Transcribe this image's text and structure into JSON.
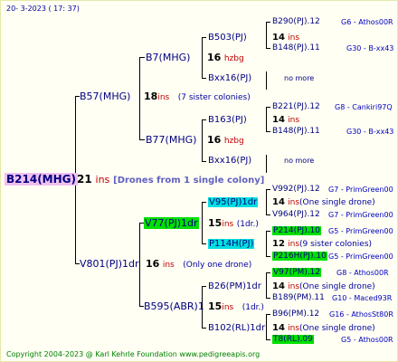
{
  "header": {
    "date": "20- 3-2023 ( 17: 37)"
  },
  "footer": {
    "copyright": "Copyright 2004-2023 @ Karl Kehrle Foundation www.pedigreeapis.org"
  },
  "root": {
    "name": "B214(MHG)",
    "ins_count": "21",
    "ins_label": "ins",
    "note": "[Drones from 1 single colony]"
  },
  "sire": {
    "name": "B57(MHG)",
    "ins_count": "18",
    "ins_label": "ins",
    "note": "(7 sister colonies)",
    "b7": {
      "name": "B7(MHG)",
      "ins_count": "16",
      "ins_label": "hzbg"
    },
    "b503": {
      "name": "B503(PJ)",
      "ins_count": "14",
      "ins_label": "ins"
    },
    "b290": {
      "name": "B290(PJ).12",
      "right": "G6 - Athos00R"
    },
    "b148a": {
      "name": "B148(PJ).11",
      "right": "G30 - B-xx43"
    },
    "bxx16a": {
      "name": "Bxx16(PJ)",
      "more": "no more"
    },
    "b77": {
      "name": "B77(MHG)",
      "ins_count": "16",
      "ins_label": "hzbg"
    },
    "b163": {
      "name": "B163(PJ)",
      "ins_count": "14",
      "ins_label": "ins"
    },
    "b221": {
      "name": "B221(PJ).12",
      "right": "G8 - Cankiri97Q"
    },
    "b148b": {
      "name": "B148(PJ).11",
      "right": "G30 - B-xx43"
    },
    "bxx16b": {
      "name": "Bxx16(PJ)",
      "more": "no more"
    }
  },
  "dam": {
    "name": "V801(PJ)1dr",
    "ins_count": "16",
    "ins_label": "ins",
    "note": "(Only one drone)",
    "v77": {
      "name": "V77(PJ)1dr",
      "ins_count": "15",
      "ins_label": "ins",
      "note": "(1dr.)"
    },
    "v95": {
      "name": "V95(PJ)1dr",
      "ins_count": "14",
      "ins_label": "ins",
      "note": "(One single drone)"
    },
    "v992": {
      "name": "V992(PJ).12",
      "right": "G7 - PrimGreen00"
    },
    "v964": {
      "name": "V964(PJ).12",
      "right": "G7 - PrimGreen00"
    },
    "p114": {
      "name": "P114H(PJ)",
      "ins_count": "12",
      "ins_label": "ins",
      "note": "(9 sister colonies)"
    },
    "p214": {
      "name": "P214(PJ).10",
      "right": "G5 - PrimGreen00"
    },
    "p216": {
      "name": "P216H(PJ).10",
      "right": "G5 - PrimGreen00"
    },
    "b595": {
      "name": "B595(ABR)1",
      "ins_count": "15",
      "ins_label": "ins",
      "note": "(1dr.)"
    },
    "b26": {
      "name": "B26(PM)1dr",
      "ins_count": "14",
      "ins_label": "ins",
      "note": "(One single drone)"
    },
    "v97": {
      "name": "V97(PM).12",
      "right": "G8 - Athos00R"
    },
    "b189": {
      "name": "B189(PM).11",
      "right": "G10 - Maced93R"
    },
    "b102": {
      "name": "B102(RL)1dr",
      "ins_count": "14",
      "ins_label": "ins",
      "note": "(One single drone)"
    },
    "b96": {
      "name": "B96(PM).12",
      "right": "G16 - AthosSt80R"
    },
    "t8": {
      "name": "T8(RL).09",
      "right": "G5 - Athos00R"
    }
  }
}
